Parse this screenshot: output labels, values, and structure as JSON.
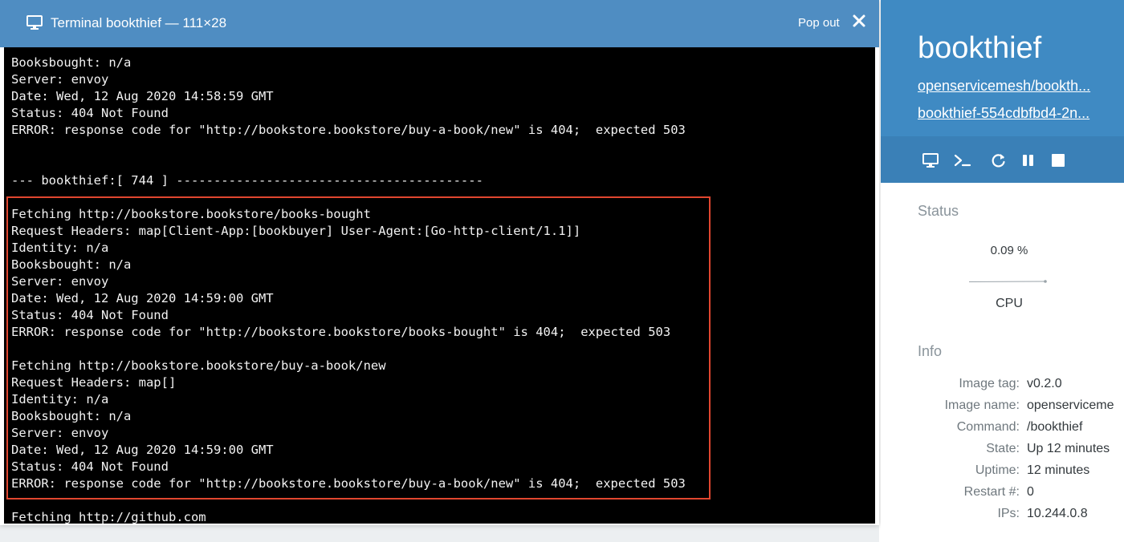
{
  "terminal": {
    "title": "Terminal bookthief — 111×28",
    "popout_label": "Pop out",
    "icons": {
      "title": "monitor-icon",
      "close": "close-icon"
    },
    "highlight_color": "#e0462f",
    "lines": [
      "Booksbought: n/a",
      "Server: envoy",
      "Date: Wed, 12 Aug 2020 14:58:59 GMT",
      "Status: 404 Not Found",
      "ERROR: response code for \"http://bookstore.bookstore/buy-a-book/new\" is 404;  expected 503",
      "",
      "",
      "--- bookthief:[ 744 ] -----------------------------------------",
      "",
      "Fetching http://bookstore.bookstore/books-bought",
      "Request Headers: map[Client-App:[bookbuyer] User-Agent:[Go-http-client/1.1]]",
      "Identity: n/a",
      "Booksbought: n/a",
      "Server: envoy",
      "Date: Wed, 12 Aug 2020 14:59:00 GMT",
      "Status: 404 Not Found",
      "ERROR: response code for \"http://bookstore.bookstore/books-bought\" is 404;  expected 503",
      "",
      "Fetching http://bookstore.bookstore/buy-a-book/new",
      "Request Headers: map[]",
      "Identity: n/a",
      "Booksbought: n/a",
      "Server: envoy",
      "Date: Wed, 12 Aug 2020 14:59:00 GMT",
      "Status: 404 Not Found",
      "ERROR: response code for \"http://bookstore.bookstore/buy-a-book/new\" is 404;  expected 503",
      "",
      "Fetching http://github.com"
    ]
  },
  "sidebar": {
    "title": "bookthief",
    "links": [
      "openservicemesh/bookth...",
      "bookthief-554cdbfbd4-2n..."
    ],
    "toolbar_icons": [
      "monitor-icon",
      "terminal-icon",
      "restart-icon",
      "pause-icon",
      "stop-icon"
    ],
    "status_heading": "Status",
    "cpu_value": "0.09 %",
    "cpu_label": "CPU",
    "info_heading": "Info",
    "info": [
      {
        "label": "Image tag:",
        "value": "v0.2.0"
      },
      {
        "label": "Image name:",
        "value": "openserviceme"
      },
      {
        "label": "Command:",
        "value": "/bookthief"
      },
      {
        "label": "State:",
        "value": "Up 12 minutes"
      },
      {
        "label": "Uptime:",
        "value": "12 minutes"
      },
      {
        "label": "Restart #:",
        "value": "0"
      },
      {
        "label": "IPs:",
        "value": "10.244.0.8"
      }
    ]
  },
  "colors": {
    "header_blue": "#4f8dc2",
    "sidebar_blue": "#3f8ac3",
    "terminal_bg": "#000000",
    "terminal_fg": "#f2f2f2"
  }
}
